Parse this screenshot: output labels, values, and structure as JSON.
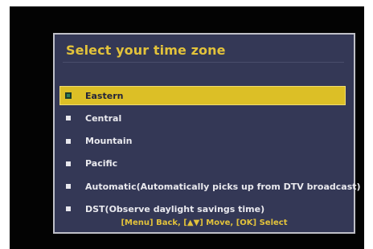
{
  "dialog": {
    "title": "Select your time zone",
    "options": [
      {
        "label": "Eastern",
        "selected": true
      },
      {
        "label": "Central",
        "selected": false
      },
      {
        "label": "Mountain",
        "selected": false
      },
      {
        "label": "Pacific",
        "selected": false
      },
      {
        "label": "Automatic(Automatically picks up from DTV broadcast)",
        "selected": false
      },
      {
        "label": "DST(Observe daylight savings time)",
        "selected": false
      }
    ],
    "footer_hint": "[Menu] Back, [▲▼] Move, [OK] Select"
  },
  "colors": {
    "screen_bg": "#030303",
    "panel_bg": "#343856",
    "title_text": "#e2c23b",
    "highlight": "#dcbf26",
    "option_text": "#e9e9ee"
  }
}
